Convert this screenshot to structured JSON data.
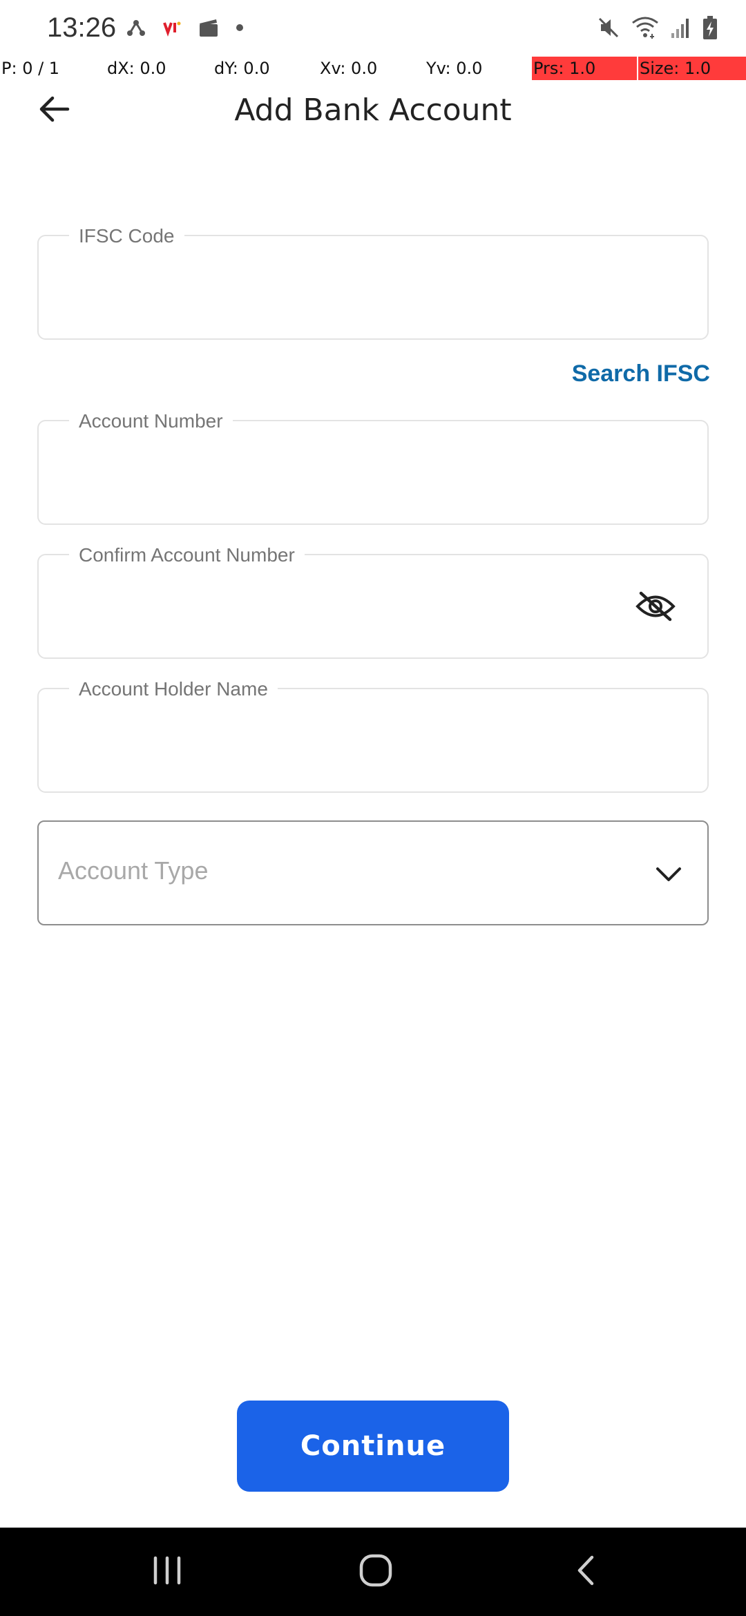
{
  "status_bar": {
    "time": "13:26",
    "left_icons": [
      "share-network-icon",
      "vi-carrier-icon",
      "clapperboard-icon",
      "dot-icon"
    ],
    "right_icons": [
      "mute-icon",
      "wifi-icon",
      "signal-icon",
      "battery-charging-icon"
    ]
  },
  "debug": {
    "p": "P: 0 / 1",
    "dx": "dX: 0.0",
    "dy": "dY: 0.0",
    "xv": "Xv: 0.0",
    "yv": "Yv: 0.0",
    "prs": "Prs: 1.0",
    "size": "Size: 1.0",
    "highlight_color": "#ff3b3b"
  },
  "header": {
    "back_icon": "arrow-left-icon",
    "title": "Add Bank Account"
  },
  "form": {
    "ifsc": {
      "label": "IFSC Code",
      "value": ""
    },
    "search_ifsc": "Search IFSC",
    "account_number": {
      "label": "Account Number",
      "value": ""
    },
    "confirm_account_number": {
      "label": "Confirm Account Number",
      "value": "",
      "toggle_icon": "eye-off-icon"
    },
    "holder_name": {
      "label": "Account Holder Name",
      "value": ""
    },
    "account_type": {
      "placeholder": "Account Type",
      "icon": "chevron-down-icon"
    }
  },
  "actions": {
    "continue_label": "Continue",
    "primary_color": "#1b63e8",
    "link_color": "#0f6aa8"
  },
  "nav_bar": {
    "buttons": [
      "recent-apps-icon",
      "home-icon",
      "back-icon"
    ]
  }
}
